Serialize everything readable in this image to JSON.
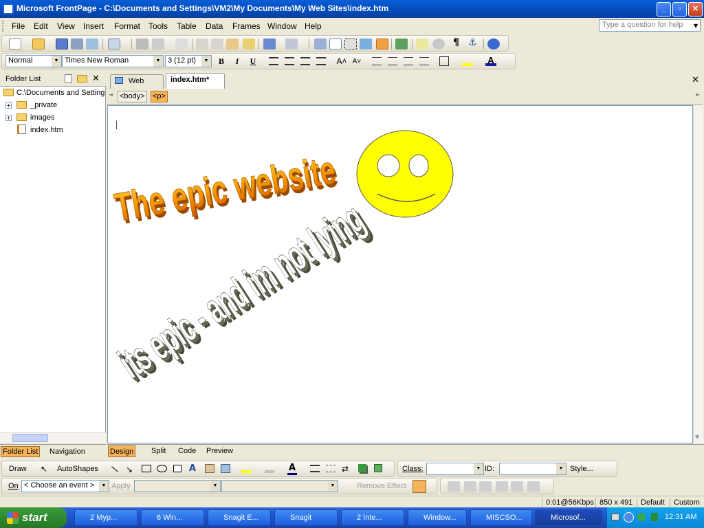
{
  "window": {
    "title": "Microsoft FrontPage - C:\\Documents and Settings\\VM2\\My Documents\\My Web Sites\\index.htm"
  },
  "menu": [
    "File",
    "Edit",
    "View",
    "Insert",
    "Format",
    "Tools",
    "Table",
    "Data",
    "Frames",
    "Window",
    "Help"
  ],
  "help_placeholder": "Type a question for help",
  "formatting": {
    "style": "Normal",
    "font": "Times New Roman",
    "size": "3  (12 pt)",
    "bold": "B",
    "italic": "I",
    "underline": "U"
  },
  "folder_list": {
    "title": "Folder List",
    "root": "C:\\Documents and Settings",
    "items": [
      {
        "label": "_private",
        "type": "folder"
      },
      {
        "label": "images",
        "type": "folder"
      },
      {
        "label": "index.htm",
        "type": "file"
      }
    ]
  },
  "tabs": [
    {
      "label": "Web Site"
    },
    {
      "label": "index.htm*"
    }
  ],
  "quick_tags": [
    "<body>",
    "<p>"
  ],
  "content": {
    "wordart1": "The epic website",
    "wordart2": "its epic - and im not lying",
    "cursor_char": "|"
  },
  "panel_views": {
    "folder_list": "Folder List",
    "navigation": "Navigation"
  },
  "view_tabs": [
    "Design",
    "Split",
    "Code",
    "Preview"
  ],
  "drawing": {
    "draw": "Draw",
    "autoshapes": "AutoShapes",
    "class_label": "Class:",
    "id_label": "ID:",
    "style": "Style..."
  },
  "dhtml": {
    "on_label": "On",
    "event": "< Choose an event >",
    "apply": "Apply",
    "remove_effect": "Remove Effect"
  },
  "status": {
    "speed": "0:01@56Kbps",
    "size": "850 x 491",
    "default": "Default",
    "custom": "Custom"
  },
  "taskbar": {
    "start": "start",
    "tasks": [
      "2 Myp...",
      "6 Win...",
      "Snagit E...",
      "Snagit",
      "2 Inte...",
      "Window...",
      "MISCSO...",
      "Microsof..."
    ],
    "clock": "12:31 AM"
  },
  "colors": {
    "smiley_fill": "#ffff00",
    "wordart1_fill": "#f0a000",
    "wordart2_fill": "#ffffff",
    "wordart2_shadow": "#4a4a3a",
    "titlebar": "#0653c9",
    "taskbar": "#245edc"
  }
}
